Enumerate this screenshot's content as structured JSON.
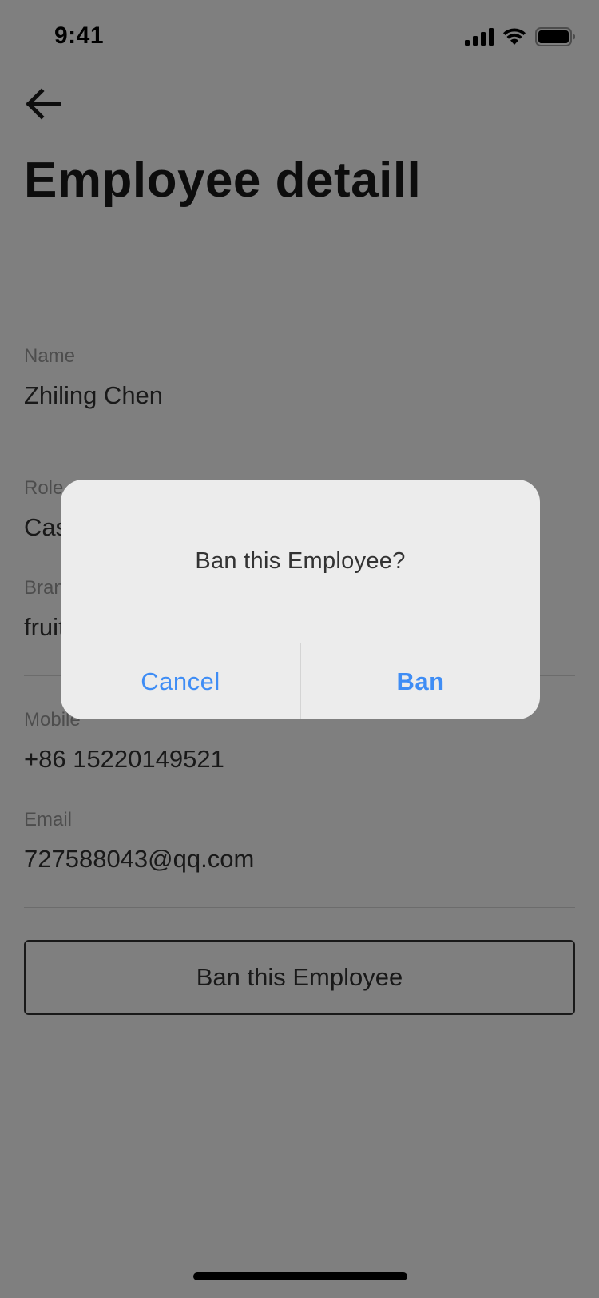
{
  "status_bar": {
    "time": "9:41",
    "icons": [
      "signal-icon",
      "wifi-icon",
      "battery-icon"
    ]
  },
  "header": {
    "back_icon": "arrow-left-icon",
    "title": "Employee detaill"
  },
  "fields": {
    "name": {
      "label": "Name",
      "value": "Zhiling Chen"
    },
    "role": {
      "label": "Role",
      "value": "Cashier"
    },
    "brand": {
      "label": "Brand",
      "value": "fruitday"
    },
    "mobile": {
      "label": "Mobile",
      "value": "+86 15220149521"
    },
    "email": {
      "label": "Email",
      "value": "727588043@qq.com"
    }
  },
  "actions": {
    "ban_label": "Ban this Employee"
  },
  "dialog": {
    "message": "Ban this Employee?",
    "cancel_label": "Cancel",
    "confirm_label": "Ban"
  },
  "colors": {
    "accent": "#3f8df5",
    "overlay": "rgba(0,0,0,0.5)",
    "dialog_bg": "#ececec"
  }
}
